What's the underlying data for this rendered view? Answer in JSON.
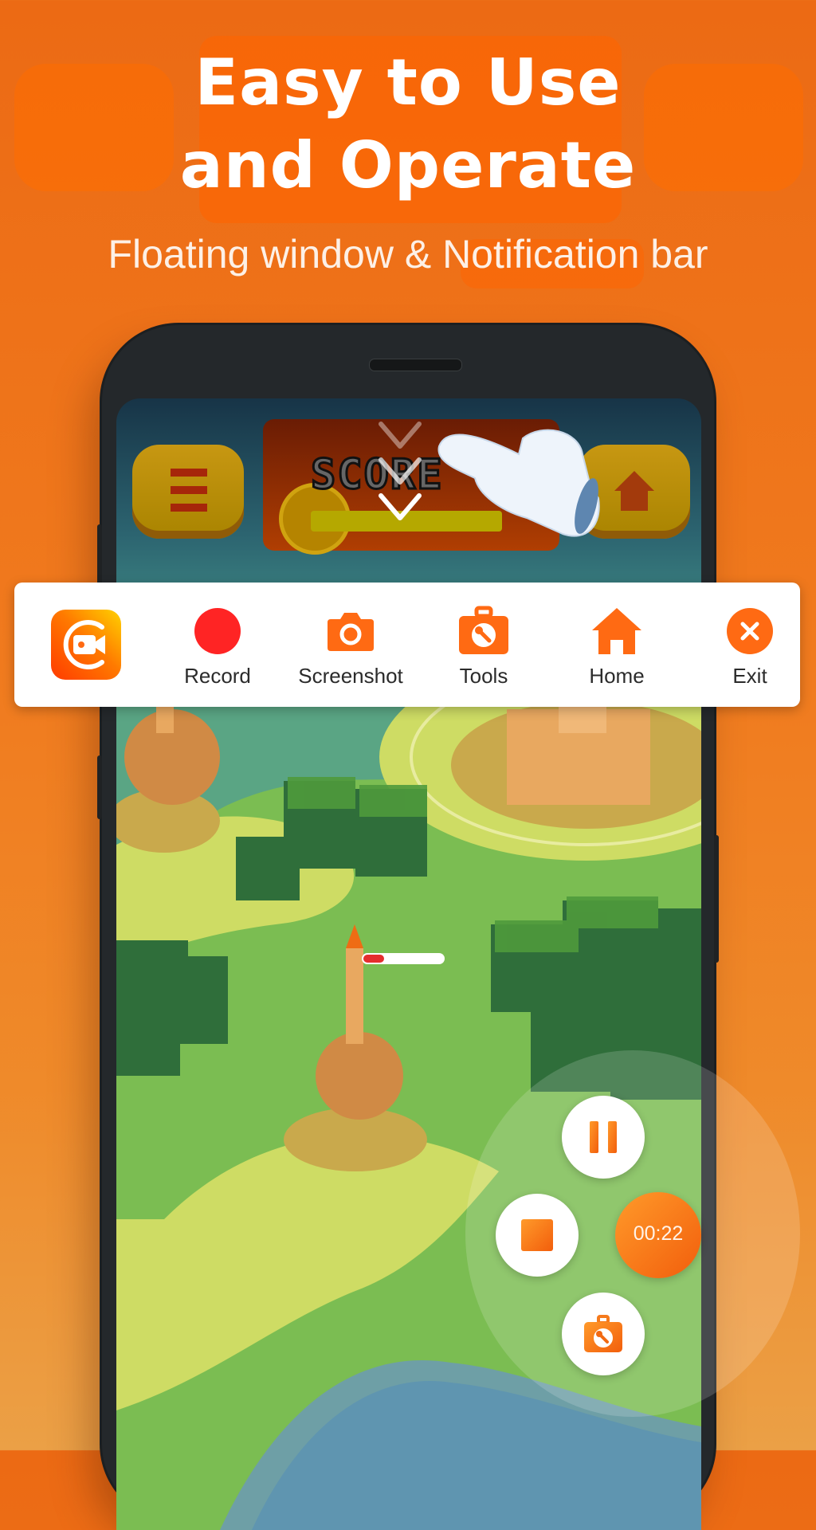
{
  "headline": {
    "line1": "Easy to Use",
    "line2": "and Operate",
    "subtitle": "Floating window & Notification bar"
  },
  "game": {
    "score_label": "SCORE"
  },
  "toolbar": {
    "app_icon": "screen-recorder-logo",
    "items": [
      {
        "label": "Record",
        "icon": "record-dot-icon",
        "color": "#ff2424"
      },
      {
        "label": "Screenshot",
        "icon": "camera-icon",
        "color": "#ff6a13"
      },
      {
        "label": "Tools",
        "icon": "toolbox-icon",
        "color": "#ff6a13"
      },
      {
        "label": "Home",
        "icon": "home-icon",
        "color": "#ff6a13"
      },
      {
        "label": "Exit",
        "icon": "close-circle-icon",
        "color": "#ff6a13"
      }
    ]
  },
  "floating_controls": {
    "pause": "pause-icon",
    "stop": "stop-icon",
    "timer": "00:22",
    "tools": "toolbox-icon"
  },
  "colors": {
    "accent": "#ff6a13",
    "record": "#ff2424",
    "background": "#ef7a1e"
  }
}
